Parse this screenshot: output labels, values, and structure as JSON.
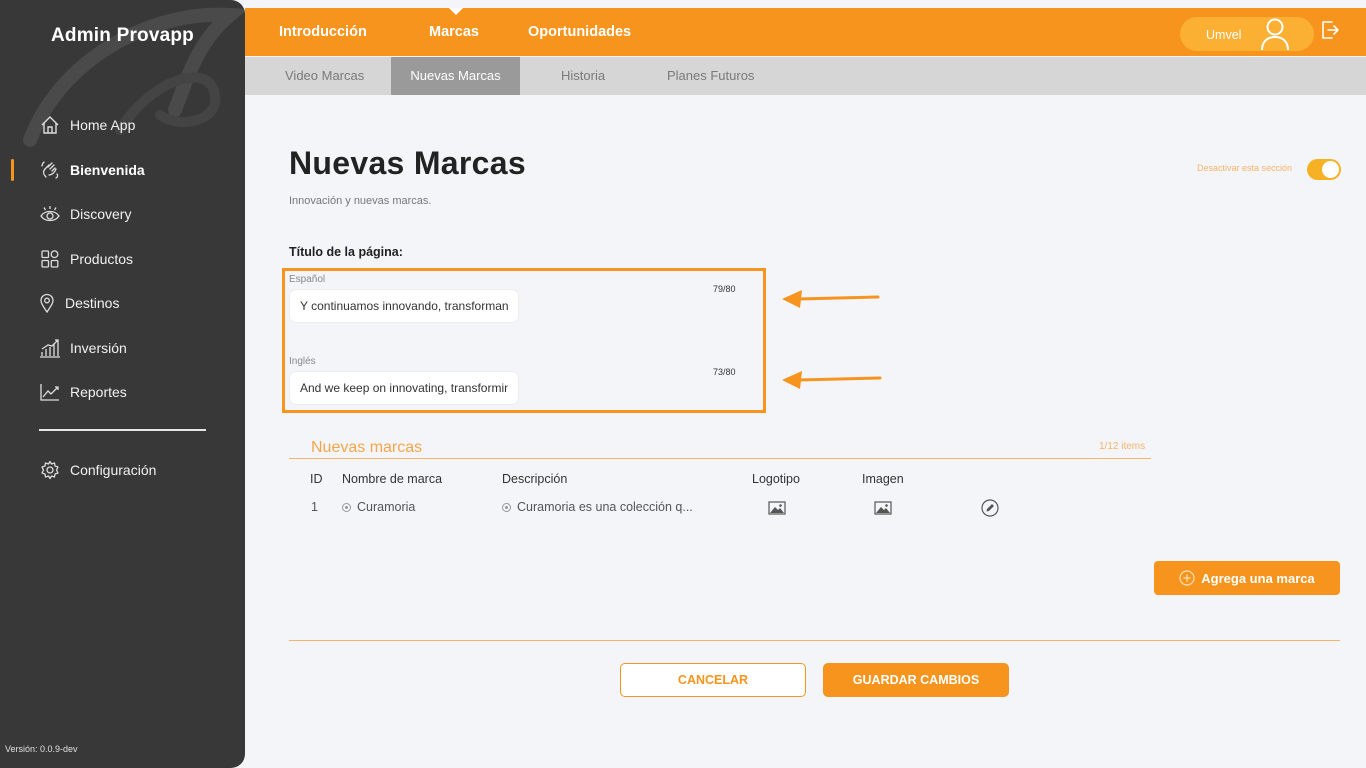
{
  "app": {
    "brand": "Admin Provapp",
    "version": "Versión: 0.0.9-dev"
  },
  "sidebar": {
    "items": [
      {
        "label": "Home App",
        "icon": "home-icon"
      },
      {
        "label": "Bienvenida",
        "icon": "waving-hand-icon",
        "active": true
      },
      {
        "label": "Discovery",
        "icon": "eye-icon"
      },
      {
        "label": "Productos",
        "icon": "grid-shapes-icon"
      },
      {
        "label": "Destinos",
        "icon": "location-pin-icon"
      },
      {
        "label": "Inversión",
        "icon": "bar-growth-icon"
      },
      {
        "label": "Reportes",
        "icon": "line-chart-icon"
      }
    ],
    "config": {
      "label": "Configuración",
      "icon": "gear-icon"
    }
  },
  "topnav": {
    "tabs": [
      "Introducción",
      "Marcas",
      "Oportunidades"
    ],
    "active": "Marcas",
    "user": "Umvel"
  },
  "subnav": {
    "tabs": [
      "Video Marcas",
      "Nuevas Marcas",
      "Historia",
      "Planes Futuros"
    ],
    "active": "Nuevas Marcas"
  },
  "page": {
    "title": "Nuevas Marcas",
    "subtitle": "Innovación y nuevas marcas.",
    "toggle_label": "Desactivar esta sección",
    "toggle_on": true
  },
  "title_fields": {
    "label": "Título de la página:",
    "spanish": {
      "lang": "Español",
      "count": "79/80",
      "value": "Y continuamos innovando, transformando"
    },
    "english": {
      "lang": "Inglés",
      "count": "73/80",
      "value": "And we keep on innovating, transforming"
    }
  },
  "brands": {
    "title": "Nuevas marcas",
    "count": "1/12 items",
    "headers": [
      "ID",
      "Nombre de marca",
      "Descripción",
      "Logotipo",
      "Imagen"
    ],
    "rows": [
      {
        "id": "1",
        "name": "Curamoria",
        "description": "Curamoria es una colección q..."
      }
    ],
    "add_label": "Agrega una marca"
  },
  "actions": {
    "cancel": "CANCELAR",
    "save": "GUARDAR CAMBIOS"
  },
  "colors": {
    "accent": "#f7941d",
    "sidebar": "#383838",
    "subbar": "#d6d6d6"
  }
}
